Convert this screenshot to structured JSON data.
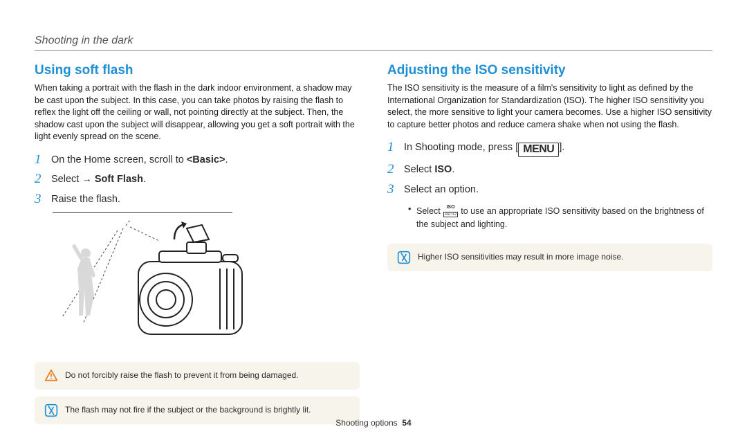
{
  "header": {
    "section": "Shooting in the dark"
  },
  "left": {
    "heading": "Using soft flash",
    "para": "When taking a portrait with the flash in the dark indoor environment, a shadow may be cast upon the subject. In this case, you can take photos by raising the flash to reflex the light off the ceiling or wall, not pointing directly at the subject. Then, the shadow cast upon the subject will disappear, allowing you get a soft portrait with the light evenly spread on the scene.",
    "steps": {
      "s1": {
        "pre": "On the Home screen, scroll to ",
        "bold": "<Basic>",
        "post": "."
      },
      "s2": {
        "pre": "Select   → ",
        "bold": "Soft Flash",
        "post": "."
      },
      "s3": {
        "text": "Raise the flash."
      }
    },
    "note1": "Do not forcibly raise the flash to prevent it from being damaged.",
    "note2": "The flash may not fire if the subject or the background is brightly lit."
  },
  "right": {
    "heading": "Adjusting the ISO sensitivity",
    "para": "The ISO sensitivity is the measure of a film's sensitivity to light as defined by the International Organization for Standardization (ISO). The higher ISO sensitivity you select, the more sensitive to light your camera becomes. Use a higher ISO sensitivity to capture better photos and reduce camera shake when not using the flash.",
    "steps": {
      "s1": {
        "pre": "In Shooting mode, press [",
        "menu": "MENU",
        "post": "]."
      },
      "s2": {
        "pre": "Select ",
        "bold": "ISO",
        "post": "."
      },
      "s3": {
        "text": "Select an option."
      }
    },
    "sub": {
      "pre": "Select ",
      "post": " to use an appropriate ISO sensitivity based on the brightness of the subject and lighting."
    },
    "note": "Higher ISO sensitivities may result in more image noise."
  },
  "footer": {
    "label": "Shooting options",
    "page": "54"
  }
}
